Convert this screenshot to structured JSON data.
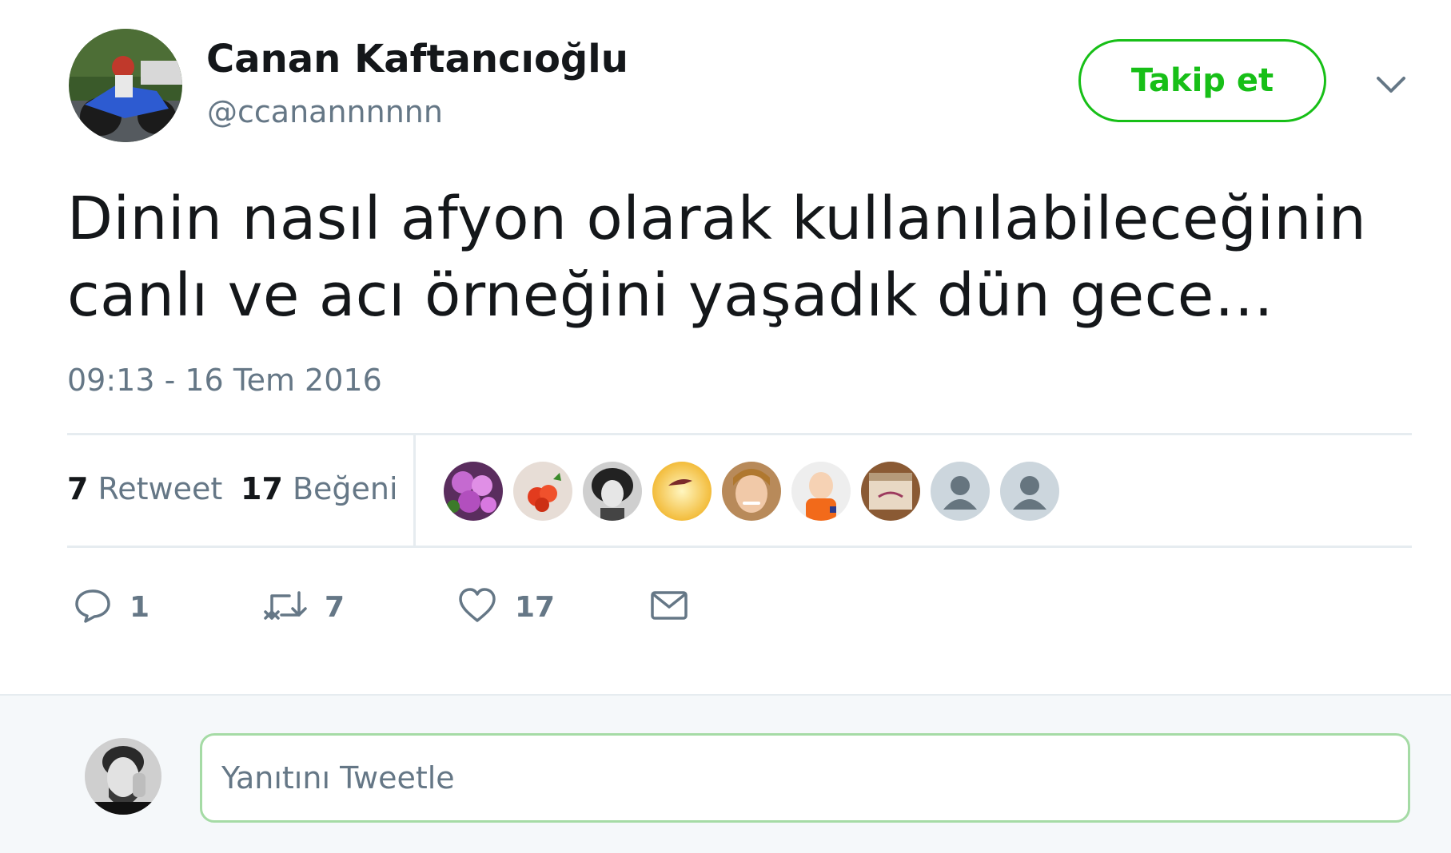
{
  "author": {
    "display_name": "Canan Kaftancıoğlu",
    "handle": "@ccanannnnnn"
  },
  "follow_button": {
    "label": "Takip et"
  },
  "tweet": {
    "text": "Dinin nasıl afyon olarak kullanılabileceğinin canlı ve acı örneğini yaşadık dün gece…",
    "timestamp": "09:13 - 16 Tem 2016"
  },
  "stats": {
    "retweets": {
      "count": "7",
      "label": "Retweet"
    },
    "likes": {
      "count": "17",
      "label": "Beğeni"
    }
  },
  "likers": [
    {
      "icon": "flowers-avatar"
    },
    {
      "icon": "red-roses-avatar"
    },
    {
      "icon": "bw-portrait-avatar"
    },
    {
      "icon": "yellow-bird-avatar"
    },
    {
      "icon": "woman-avatar"
    },
    {
      "icon": "baby-avatar"
    },
    {
      "icon": "box-avatar"
    },
    {
      "icon": "default-avatar"
    },
    {
      "icon": "default-avatar"
    }
  ],
  "actions": {
    "reply": {
      "icon": "reply-icon",
      "count": "1"
    },
    "retweet": {
      "icon": "retweet-icon",
      "count": "7"
    },
    "like": {
      "icon": "heart-icon",
      "count": "17"
    },
    "dm": {
      "icon": "envelope-icon"
    }
  },
  "reply_box": {
    "placeholder": "Yanıtını Tweetle"
  },
  "colors": {
    "follow_green": "#17bf17",
    "muted_text": "#657786",
    "divider": "#e6ecf0",
    "reply_background": "#f5f8fa"
  }
}
